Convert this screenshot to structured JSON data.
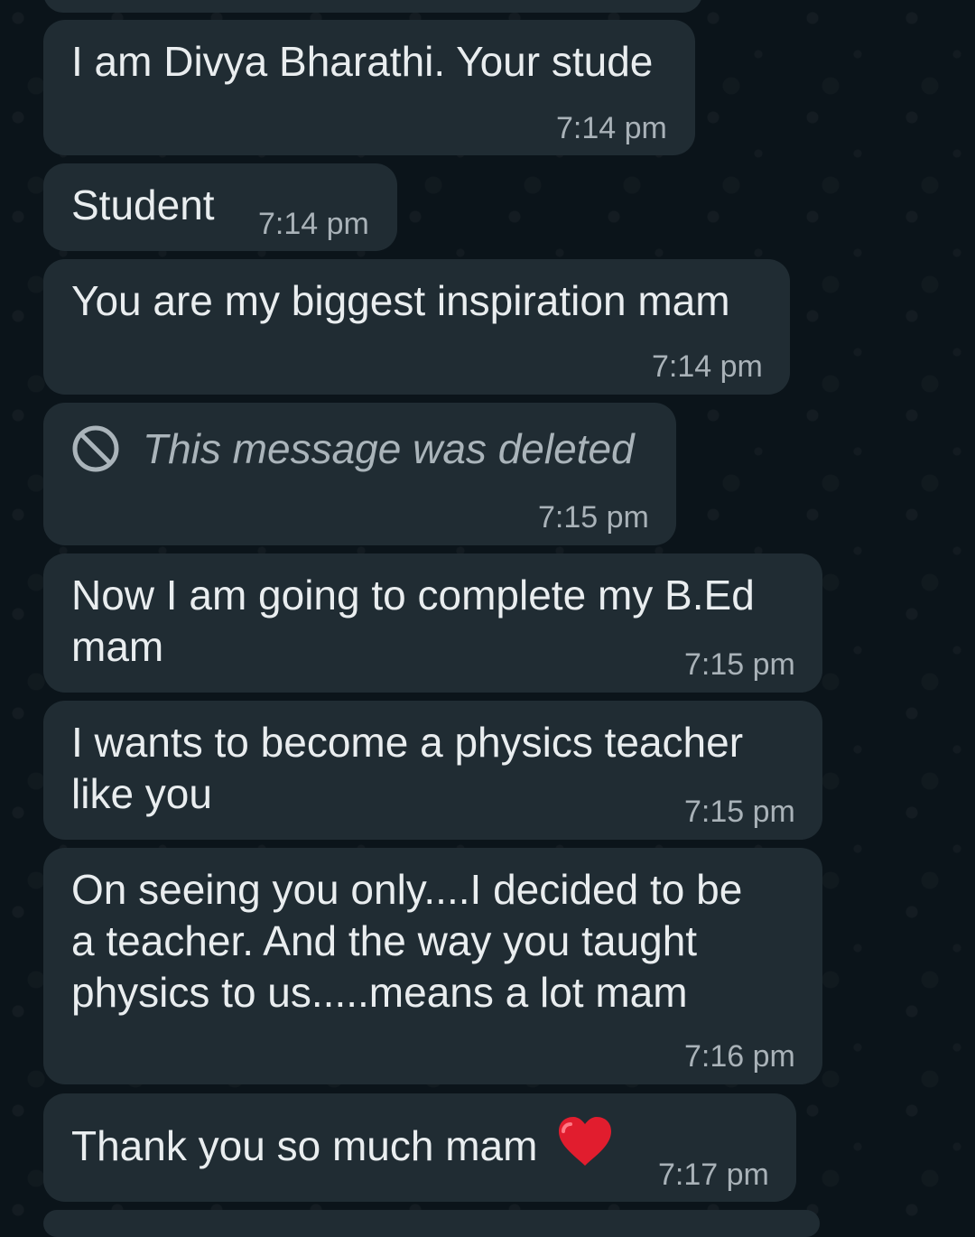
{
  "messages": [
    {
      "text": "",
      "time": ""
    },
    {
      "text": "I am Divya Bharathi. Your stude",
      "time": "7:14 pm"
    },
    {
      "text": "Student",
      "time": "7:14 pm"
    },
    {
      "text": "You are my biggest inspiration mam",
      "time": "7:14 pm"
    },
    {
      "text": "This message was deleted",
      "time": "7:15 pm",
      "deleted": true,
      "icon": "deleted-icon"
    },
    {
      "text": "Now I am going to complete my B.Ed\nmam",
      "time": "7:15 pm"
    },
    {
      "text": "I wants to become a physics teacher\nlike you",
      "time": "7:15 pm"
    },
    {
      "text": "On seeing you only....I decided to be\na teacher. And the way you taught\nphysics to us.....means a lot mam",
      "time": "7:16 pm"
    },
    {
      "text": "Thank you so much mam",
      "time": "7:17 pm",
      "emoji": "red-heart-icon"
    }
  ],
  "colors": {
    "background": "#0b141a",
    "bubble": "#202c33",
    "text": "#e9edef",
    "timestamp": "#a9b2b8",
    "heart": "#e11d2e"
  }
}
